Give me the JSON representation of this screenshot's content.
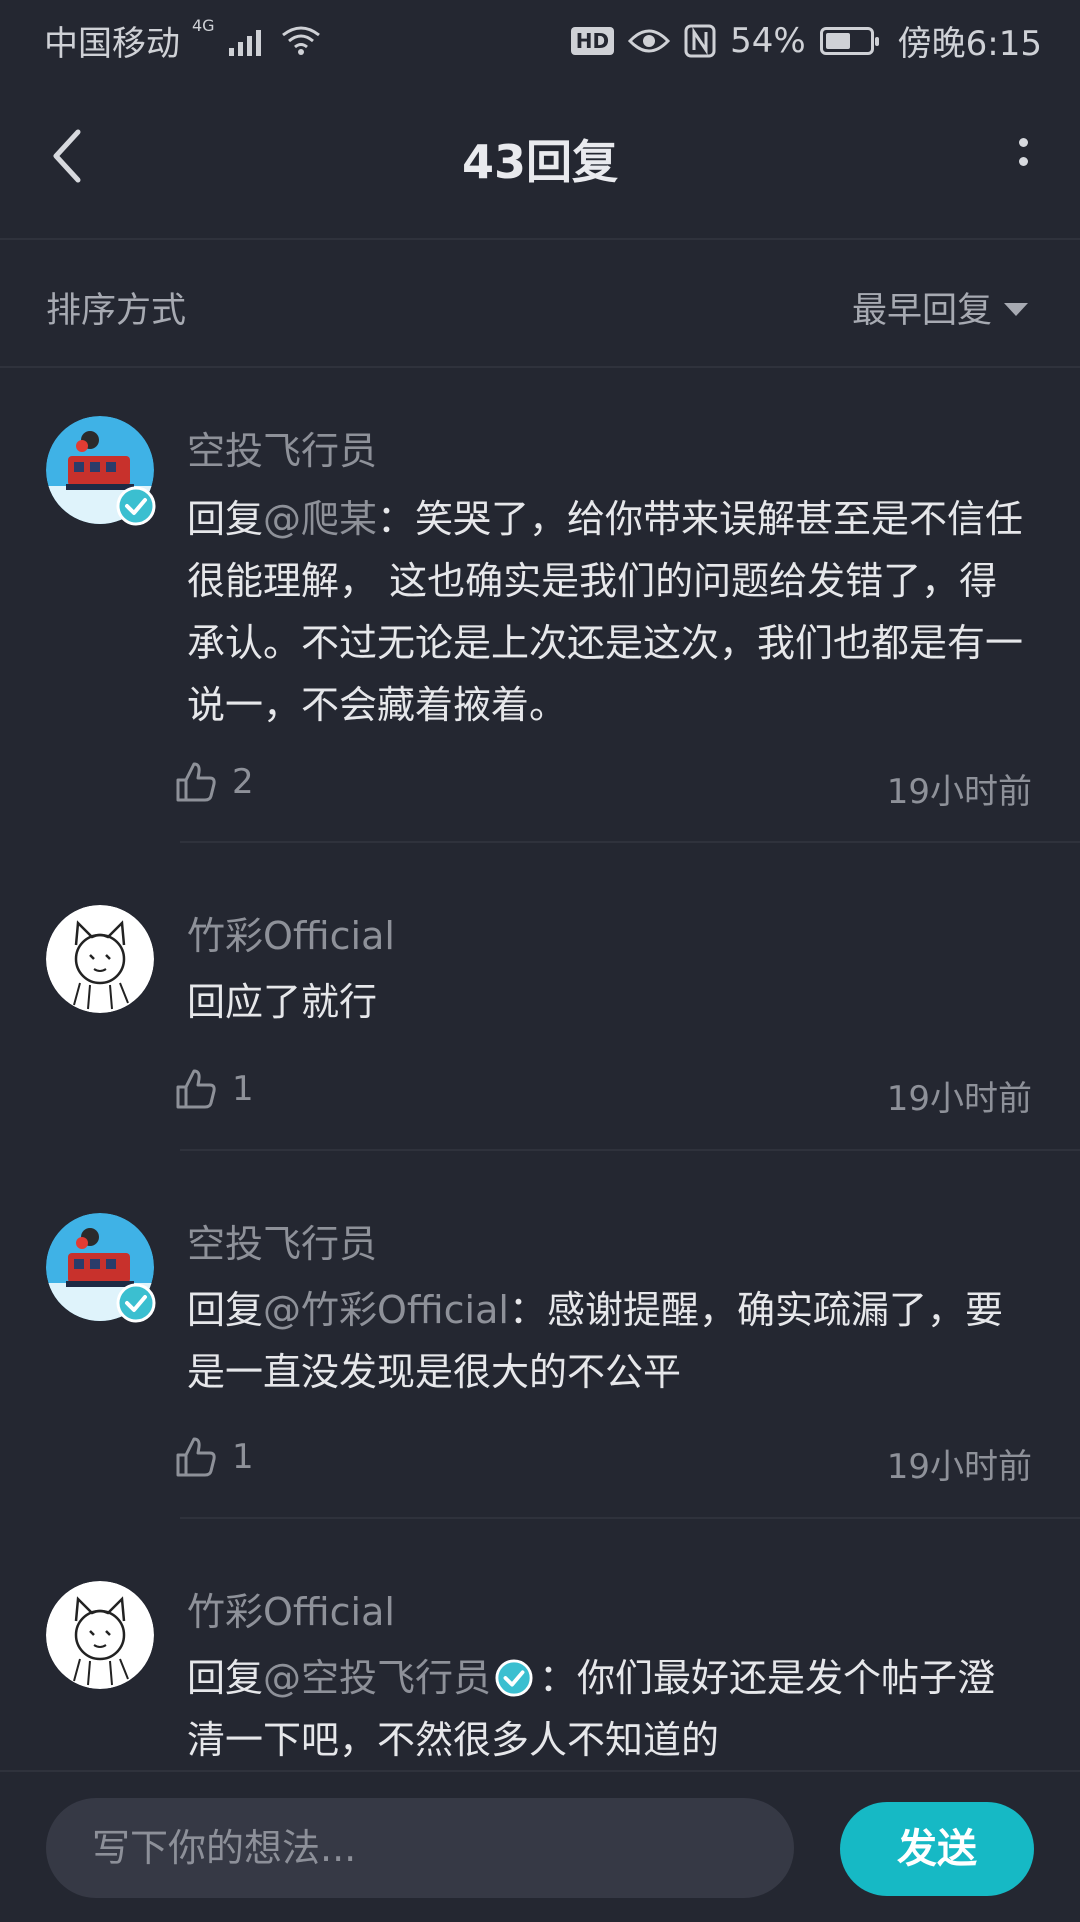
{
  "status_bar": {
    "carrier": "中国移动",
    "network": "4G",
    "battery": "54%",
    "time": "傍晚6:15",
    "hd_badge": "HD"
  },
  "header": {
    "title": "43回复"
  },
  "sort": {
    "label": "排序方式",
    "value": "最早回复"
  },
  "comments": [
    {
      "username": "空投飞行员",
      "verified": true,
      "reply_prefix": "回复",
      "mention": "@爬某",
      "text": "：笑哭了，给你带来误解甚至是不信任很能理解， 这也确实是我们的问题给发错了，得承认。不过无论是上次还是这次，我们也都是有一说一，不会藏着掖着。",
      "likes": "2",
      "time": "19小时前"
    },
    {
      "username": "竹彩Official",
      "verified": false,
      "text": "回应了就行",
      "likes": "1",
      "time": "19小时前"
    },
    {
      "username": "空投飞行员",
      "verified": true,
      "reply_prefix": "回复",
      "mention": "@竹彩Official",
      "text": "：感谢提醒，确实疏漏了，要是一直没发现是很大的不公平",
      "likes": "1",
      "time": "19小时前"
    },
    {
      "username": "竹彩Official",
      "verified": false,
      "reply_prefix": "回复",
      "mention": "@空投飞行员",
      "text": "：你们最好还是发个帖子澄清一下吧，不然很多人不知道的"
    }
  ],
  "composer": {
    "placeholder": "写下你的想法...",
    "send_label": "发送"
  },
  "colors": {
    "background": "#242731",
    "accent": "#16b9c5",
    "muted_text": "#8e9199"
  }
}
